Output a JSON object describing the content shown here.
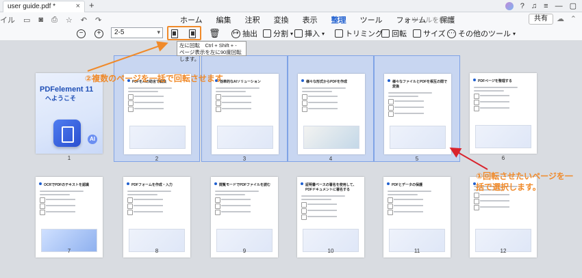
{
  "titlebar": {
    "tab_title": "user guide.pdf *",
    "close": "×",
    "new_tab": "+"
  },
  "menubar": {
    "left_label": "イル",
    "items": [
      "ホーム",
      "編集",
      "注釈",
      "変換",
      "表示",
      "整理",
      "ツール",
      "フォーム",
      "保護"
    ],
    "active_index": 5,
    "search_placeholder": "ツールを検索",
    "share_label": "共有"
  },
  "toolbar": {
    "zoom_out": "−",
    "zoom_in": "+",
    "page_range": "2-5",
    "extract": "抽出",
    "split": "分割",
    "insert": "挿入",
    "trim": "トリミング",
    "rotate": "回転",
    "size": "サイズ",
    "more_tools": "その他のツール"
  },
  "tooltip": {
    "line1": "左に回転　Ctrl + Shift + -",
    "line2": "ページ表示を左に90度回転します。"
  },
  "pages": [
    {
      "num": "1",
      "title": "",
      "selected": false,
      "cover": true,
      "brand": "PDFelement 11",
      "welcome": "へようこそ",
      "ai": "AI"
    },
    {
      "num": "2",
      "title": "PDFをAIの助言で編集",
      "selected": true
    },
    {
      "num": "3",
      "title": "効率的なAIソリューション",
      "selected": true
    },
    {
      "num": "4",
      "title": "様々な形式からPDFを作成",
      "selected": true
    },
    {
      "num": "5",
      "title": "様々なファイルとPDFを相互の間で変換",
      "selected": true
    },
    {
      "num": "6",
      "title": "PDFページを整理する",
      "selected": false
    },
    {
      "num": "7",
      "title": "OCRでPDFのテキストを認識",
      "selected": false
    },
    {
      "num": "8",
      "title": "PDFフォームを作成・入力",
      "selected": false
    },
    {
      "num": "9",
      "title": "閲覧モードでPDFファイルを読む",
      "selected": false
    },
    {
      "num": "10",
      "title": "証明書ベースの署名を使用して、PDFドキュメントに署名する",
      "selected": false
    },
    {
      "num": "11",
      "title": "PDFとデータの保護",
      "selected": false
    },
    {
      "num": "12",
      "title": "",
      "selected": false
    }
  ],
  "annotations": {
    "orange_note": "②複数のページを一括で回転させます",
    "red_note": "①回転させたいページを一括で選択します。"
  },
  "colors": {
    "accent": "#1f5fcf",
    "selection": "#c8d6f1",
    "annotation_orange": "#f08a2a",
    "annotation_red": "#d9232d"
  }
}
